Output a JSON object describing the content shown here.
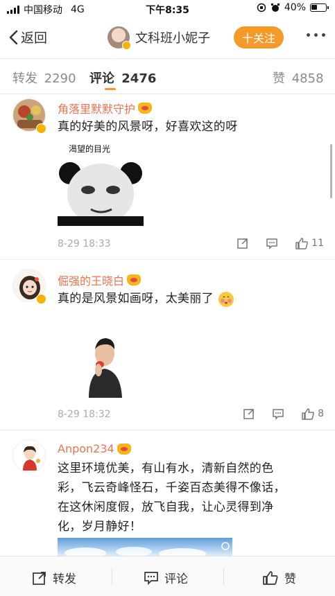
{
  "status_bar": {
    "carrier": "中国移动",
    "network": "4G",
    "time": "下午8:35",
    "battery": "40%"
  },
  "nav": {
    "back_label": "返回",
    "title": "文科班小妮子",
    "follow_label": "十关注"
  },
  "tabs": [
    {
      "label": "转发",
      "count": "2290"
    },
    {
      "label": "评论",
      "count": "2476"
    },
    {
      "label": "赞",
      "count": "4858"
    }
  ],
  "comments": [
    {
      "name": "角落里默默守护",
      "text": "真的好美的风景呀，好喜欢这的呀",
      "sticker_caption": "渴望的目光",
      "time": "8-29 18:33",
      "likes": "11"
    },
    {
      "name": "倔强的王晓白",
      "text": "真的是风景如画呀，太美丽了",
      "time": "8-29 18:32",
      "likes": "8"
    },
    {
      "name": "Anpon234",
      "text_lines": [
        "这里环境优美，有山有水，清新自然的色",
        "彩，飞云奇峰怪石，千姿百态美得不像话，",
        "在这休闲度假，放飞自我，让心灵得到净",
        "化，岁月静好！"
      ]
    }
  ],
  "bottom_bar": {
    "repost_label": "转发",
    "comment_label": "评论",
    "like_label": "赞"
  },
  "colors": {
    "accent": "#f39a2b",
    "username": "#eb7350",
    "time": "#aaaaaa"
  },
  "icons": [
    "signal-icon",
    "alarm-icon",
    "battery-icon",
    "back-chevron-icon",
    "more-icon",
    "repost-icon",
    "comment-icon",
    "like-icon",
    "vip-crown-icon",
    "verified-badge-icon"
  ]
}
